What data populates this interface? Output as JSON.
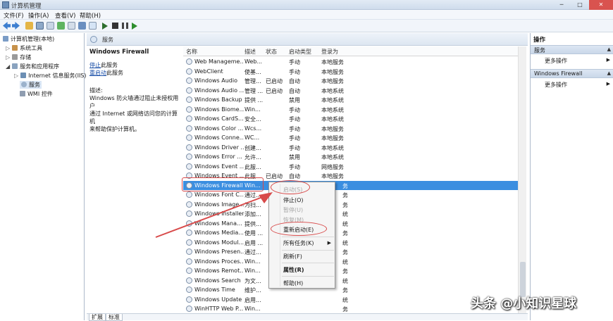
{
  "window": {
    "title": "计算机管理",
    "buttons": [
      "─",
      "□",
      "✕"
    ]
  },
  "menu": [
    "文件(F)",
    "操作(A)",
    "查看(V)",
    "帮助(H)"
  ],
  "tree": [
    {
      "label": "计算机管理(本地)"
    },
    {
      "label": "系统工具"
    },
    {
      "label": "存储"
    },
    {
      "label": "服务和应用程序"
    },
    {
      "label": "Internet 信息服务(IIS)管"
    },
    {
      "label": "服务"
    },
    {
      "label": "WMI 控件"
    }
  ],
  "breadcrumb": "服务",
  "detail": {
    "title": "Windows Firewall",
    "stop_link": "停止",
    "stop_suffix": "此服务",
    "restart_link": "重启动",
    "restart_suffix": "此服务",
    "desc_label": "描述:",
    "desc_lines": [
      "Windows 防火墙通过阻止未授权用户",
      "通过 Internet 或网络访问您的计算机",
      "来帮助保护计算机。"
    ]
  },
  "columns": [
    "名称",
    "描述",
    "状态",
    "启动类型",
    "登录为"
  ],
  "rows": [
    {
      "name": "Web Manageme...",
      "desc": "Web...",
      "status": "",
      "startup": "手动",
      "logon": "本地服务"
    },
    {
      "name": "WebClient",
      "desc": "使基...",
      "status": "",
      "startup": "手动",
      "logon": "本地服务"
    },
    {
      "name": "Windows Audio",
      "desc": "管理...",
      "status": "已启动",
      "startup": "自动",
      "logon": "本地服务"
    },
    {
      "name": "Windows Audio ...",
      "desc": "管理 ...",
      "status": "已启动",
      "startup": "自动",
      "logon": "本地系统"
    },
    {
      "name": "Windows Backup",
      "desc": "提供 ...",
      "status": "",
      "startup": "禁用",
      "logon": "本地系统"
    },
    {
      "name": "Windows Biome...",
      "desc": "Win...",
      "status": "",
      "startup": "手动",
      "logon": "本地系统"
    },
    {
      "name": "Windows CardS...",
      "desc": "安全...",
      "status": "",
      "startup": "手动",
      "logon": "本地系统"
    },
    {
      "name": "Windows Color ...",
      "desc": "Wcs...",
      "status": "",
      "startup": "手动",
      "logon": "本地服务"
    },
    {
      "name": "Windows Conne...",
      "desc": "WC...",
      "status": "",
      "startup": "手动",
      "logon": "本地服务"
    },
    {
      "name": "Windows Driver ...",
      "desc": "创建...",
      "status": "",
      "startup": "手动",
      "logon": "本地系统"
    },
    {
      "name": "Windows Error ...",
      "desc": "允许...",
      "status": "",
      "startup": "禁用",
      "logon": "本地系统"
    },
    {
      "name": "Windows Event ...",
      "desc": "此服...",
      "status": "",
      "startup": "手动",
      "logon": "网络服务"
    },
    {
      "name": "Windows Event ...",
      "desc": "此服...",
      "status": "已启动",
      "startup": "自动",
      "logon": "本地服务"
    },
    {
      "name": "Windows Firewall",
      "desc": "Win...",
      "status": "",
      "startup": "",
      "logon": "务"
    },
    {
      "name": "Windows Font C...",
      "desc": "通过...",
      "status": "",
      "startup": "",
      "logon": "务"
    },
    {
      "name": "Windows Image...",
      "desc": "为扫...",
      "status": "",
      "startup": "",
      "logon": "务"
    },
    {
      "name": "Windows Installer",
      "desc": "添加...",
      "status": "",
      "startup": "",
      "logon": "统"
    },
    {
      "name": "Windows Mana...",
      "desc": "提供...",
      "status": "",
      "startup": "",
      "logon": "统"
    },
    {
      "name": "Windows Media...",
      "desc": "使用 ...",
      "status": "",
      "startup": "",
      "logon": "务"
    },
    {
      "name": "Windows Modul...",
      "desc": "启用 ...",
      "status": "",
      "startup": "",
      "logon": "统"
    },
    {
      "name": "Windows Presen...",
      "desc": "通过...",
      "status": "",
      "startup": "",
      "logon": "务"
    },
    {
      "name": "Windows Proces...",
      "desc": "Win...",
      "status": "",
      "startup": "",
      "logon": "统"
    },
    {
      "name": "Windows Remot...",
      "desc": "Win...",
      "status": "",
      "startup": "",
      "logon": "务"
    },
    {
      "name": "Windows Search",
      "desc": "为文...",
      "status": "",
      "startup": "",
      "logon": "统"
    },
    {
      "name": "Windows Time",
      "desc": "维护...",
      "status": "",
      "startup": "",
      "logon": "务"
    },
    {
      "name": "Windows Update",
      "desc": "启用...",
      "status": "",
      "startup": "",
      "logon": "统"
    },
    {
      "name": "WinHTTP Web P...",
      "desc": "Win...",
      "status": "",
      "startup": "",
      "logon": "务"
    }
  ],
  "context_menu": {
    "start": "启动(S)",
    "stop": "停止(O)",
    "pause": "暂停(U)",
    "resume": "恢复(M)",
    "restart": "重新启动(E)",
    "all_tasks": "所有任务(K)",
    "refresh": "刷新(F)",
    "properties": "属性(R)",
    "help": "帮助(H)"
  },
  "actions": {
    "title": "操作",
    "section1": "服务",
    "more1": "更多操作",
    "section2": "Windows Firewall",
    "more2": "更多操作"
  },
  "tabs": [
    "扩展",
    "标准"
  ],
  "watermark": "头条 @小知识星球",
  "colors": {
    "selection": "#3b8ee0",
    "annotation": "#d84a4a"
  }
}
